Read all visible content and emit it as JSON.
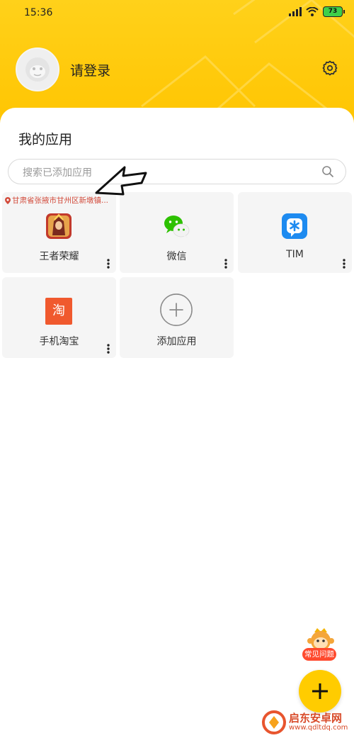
{
  "status_bar": {
    "time": "15:36",
    "battery": "73"
  },
  "profile": {
    "login_label": "请登录"
  },
  "main": {
    "section_title": "我的应用",
    "search_placeholder": "搜索已添加应用"
  },
  "apps": [
    {
      "name": "王者荣耀",
      "icon": "honor-of-kings-icon",
      "location": "甘肃省张掖市甘州区新墩镇..."
    },
    {
      "name": "微信",
      "icon": "wechat-icon"
    },
    {
      "name": "TIM",
      "icon": "tim-icon"
    },
    {
      "name": "手机淘宝",
      "icon": "taobao-icon",
      "icon_text": "淘"
    },
    {
      "name": "添加应用",
      "icon": "add-circle-icon"
    }
  ],
  "faq": {
    "label": "常见问题"
  },
  "watermark": {
    "title": "启东安卓网",
    "url": "www.qdltdq.com"
  },
  "colors": {
    "brand_yellow": "#ffcc00",
    "location_red": "#d24a3a",
    "wechat_green": "#2dc100",
    "tim_blue": "#1e8bf0",
    "taobao_orange": "#f0592e"
  }
}
